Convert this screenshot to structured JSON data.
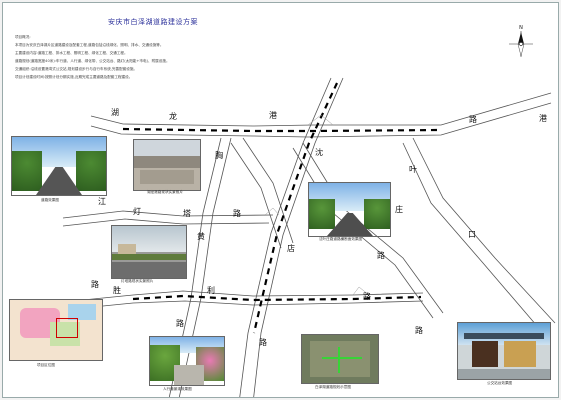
{
  "plan": {
    "title": "安庆市白泽湖道路建设方案",
    "notes": [
      "项目概况:",
      "本项目为安庆白泽湖片区道路建设及配套工程,道路包括沿线绿化、照明、排水、交通设施等。",
      "主要建设内容:道路工程、排水工程、照明工程、绿化工程、交通工程。",
      "道路规划(道路宽度40米):车行道、人行道、绿化带、公交站台、路灯(太阳能+市电)、附属设施。",
      "交通组织:沿线设置港湾式公交站,规划建设步行与自行车系统,完善配套设施。",
      "项目计划建设时间:按照计划分期实施,近期完成主要道路及配套工程建设。"
    ],
    "compass_letter": "N"
  },
  "streets": [
    {
      "name": "湖龙港路",
      "chars": [
        "湖",
        "龙",
        "港",
        "路",
        "港"
      ]
    },
    {
      "name": "江灯塔路",
      "chars": [
        "江",
        "灯",
        "塔",
        "路"
      ]
    },
    {
      "name": "胜利路",
      "chars": [
        "胜",
        "利",
        "路",
        "路"
      ]
    },
    {
      "name": "沈叶庄路",
      "chars": [
        "沈",
        "叶",
        "庄",
        "路",
        "路"
      ]
    },
    {
      "name": "口",
      "chars": [
        "口"
      ]
    },
    {
      "name": "路",
      "chars": [
        "路"
      ]
    },
    {
      "name": "胸路",
      "chars": [
        "胸",
        "路"
      ]
    },
    {
      "name": "黄店",
      "chars": [
        "黄",
        "店"
      ]
    }
  ],
  "photos": [
    {
      "id": "road-view",
      "caption": "道路效果图"
    },
    {
      "id": "site-photo-1",
      "caption": "湖龙港路现状实景照片"
    },
    {
      "id": "site-photo-2",
      "caption": "灯塔路现状实景照片"
    },
    {
      "id": "road-section",
      "caption": "沈叶庄路道路横断面效果图"
    },
    {
      "id": "location-map",
      "caption": "项目区位图"
    },
    {
      "id": "greenway",
      "caption": "人行道景观效果图"
    },
    {
      "id": "aerial-map",
      "caption": "白泽湖道路规划示意图"
    },
    {
      "id": "bus-stop",
      "caption": "公交站台效果图"
    }
  ],
  "colors": {
    "road_line": "#555555",
    "dash": "#000000",
    "title": "#2a2f9a"
  }
}
